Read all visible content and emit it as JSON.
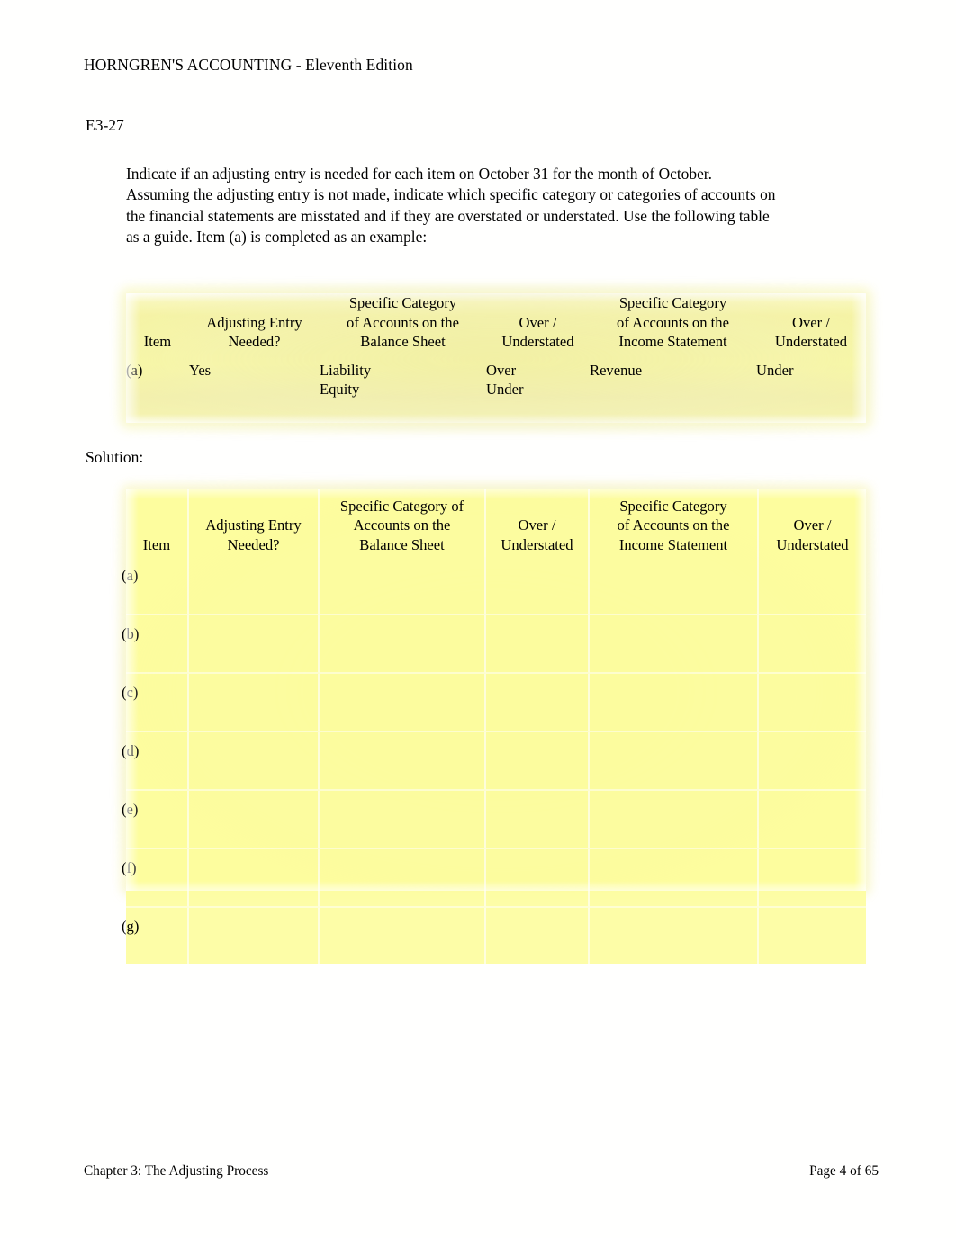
{
  "header": {
    "title": "HORNGREN'S ACCOUNTING - Eleventh Edition"
  },
  "exercise": {
    "id": "E3-27",
    "instructions": "Indicate if an adjusting entry is needed for each item on October 31 for the month of October. Assuming the adjusting entry is not made, indicate which specific category or categories of accounts on the financial statements are misstated and if they are overstated or understated. Use the following table as a guide. Item (a) is completed as an example:"
  },
  "solution": {
    "label": "Solution:"
  },
  "guide_table": {
    "columns": [
      "Item",
      "Adjusting Entry Needed?",
      "Specific Category of Accounts on the Balance Sheet",
      "Over / Understated",
      "Specific Category of Accounts on the Income Statement",
      "Over / Understated"
    ],
    "column_lines": [
      [
        "Item"
      ],
      [
        "Adjusting Entry",
        "Needed?"
      ],
      [
        "Specific Category",
        "of Accounts on the",
        "Balance Sheet"
      ],
      [
        "Over /",
        "Understated"
      ],
      [
        "Specific Category",
        "of Accounts on the",
        "Income Statement"
      ],
      [
        "Over /",
        "Understated"
      ]
    ],
    "rows": [
      {
        "item": "(a)",
        "adjusting_entry_needed": "Yes",
        "balance_sheet_category_lines": [
          "Liability",
          "Equity"
        ],
        "balance_sheet_over_under_lines": [
          "Over",
          "Under"
        ],
        "income_statement_category_lines": [
          "Revenue"
        ],
        "income_statement_over_under_lines": [
          "Under"
        ]
      }
    ]
  },
  "solution_table": {
    "column_lines": [
      [
        "Item"
      ],
      [
        "Adjusting Entry",
        "Needed?"
      ],
      [
        "Specific Category of",
        "Accounts on the",
        "Balance Sheet"
      ],
      [
        "Over /",
        "Understated"
      ],
      [
        "Specific Category",
        "of Accounts on the",
        "Income Statement"
      ],
      [
        "Over /",
        "Understated"
      ]
    ],
    "rows": [
      {
        "item": "(a)"
      },
      {
        "item": "(b)"
      },
      {
        "item": "(c)"
      },
      {
        "item": "(d)"
      },
      {
        "item": "(e)"
      },
      {
        "item": "(f)"
      },
      {
        "item": "(g)"
      }
    ]
  },
  "footer": {
    "chapter": "Chapter 3: The Adjusting Process",
    "page": "Page 4 of 65"
  },
  "colors": {
    "highlight_yellow": "#fafa9c",
    "highlight_yellow_soft": "#f7f5a0",
    "text": "#000000",
    "page_background": "#ffffff"
  }
}
